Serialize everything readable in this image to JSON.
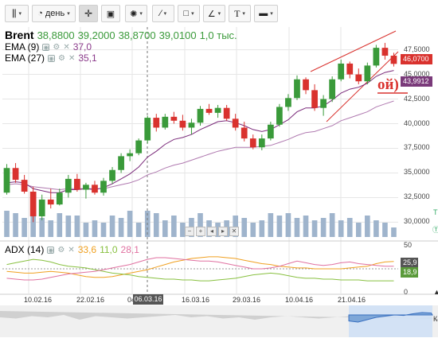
{
  "toolbar": {
    "period_label": "день",
    "caret": "▾"
  },
  "main_legend": {
    "symbol": "Brent",
    "open": "38,8800",
    "high": "39,2000",
    "low": "38,8700",
    "close": "39,0100",
    "volume": "1,0 тыс."
  },
  "ema9": {
    "label": "EMA (9)",
    "value": "37,0",
    "color": "#8b3a8b"
  },
  "ema27": {
    "label": "EMA (27)",
    "value": "35,1",
    "color": "#8b3a8b"
  },
  "adx": {
    "label": "ADX (14)",
    "v1": "33,6",
    "v2": "11,0",
    "v3": "28,1",
    "c1": "#f0a020",
    "c2": "#88c040",
    "c3": "#e070a0"
  },
  "annotation_text": "ой)",
  "price_tags": {
    "last": "46,0700",
    "ema": "43,9912",
    "adx1": "25,9",
    "adx2": "18,9",
    "last_color": "#d9322e",
    "ema_color": "#7a3a7a"
  },
  "y_axis": [
    "47,5000",
    "45,0000",
    "42,5000",
    "40,0000",
    "37,5000",
    "35,0000",
    "32,5000",
    "30,0000"
  ],
  "adx_axis": [
    "50",
    "0"
  ],
  "x_axis": [
    "10.02.16",
    "22.02.16",
    "04.03.16",
    "16.03.16",
    "29.03.16",
    "10.04.16",
    "21.04.16"
  ],
  "cursor_date": "06.03.16",
  "nav_controls": [
    "−",
    "+",
    "◂",
    "▸",
    "✕"
  ],
  "right_edge_glyphs": [
    "T",
    "Ⓣ",
    "▲",
    "К"
  ],
  "colors": {
    "up": "#3a9a3a",
    "down": "#d9322e",
    "volume": "#9fb4cc",
    "grid": "#e6e6e6"
  },
  "chart_data": {
    "type": "candlestick",
    "ylim": [
      28.5,
      49.0
    ],
    "candles": [
      {
        "o": 33.0,
        "h": 35.9,
        "l": 32.8,
        "c": 35.5
      },
      {
        "o": 35.5,
        "h": 36.0,
        "l": 34.0,
        "c": 34.3
      },
      {
        "o": 34.3,
        "h": 34.8,
        "l": 32.9,
        "c": 33.1
      },
      {
        "o": 33.1,
        "h": 33.6,
        "l": 30.0,
        "c": 30.6
      },
      {
        "o": 30.6,
        "h": 32.8,
        "l": 30.2,
        "c": 32.3
      },
      {
        "o": 32.3,
        "h": 33.4,
        "l": 31.4,
        "c": 31.8
      },
      {
        "o": 31.8,
        "h": 33.4,
        "l": 31.7,
        "c": 33.0
      },
      {
        "o": 33.0,
        "h": 34.8,
        "l": 32.5,
        "c": 34.4
      },
      {
        "o": 34.4,
        "h": 34.9,
        "l": 33.1,
        "c": 33.3
      },
      {
        "o": 33.3,
        "h": 34.0,
        "l": 32.4,
        "c": 33.8
      },
      {
        "o": 33.8,
        "h": 34.2,
        "l": 32.8,
        "c": 33.0
      },
      {
        "o": 33.0,
        "h": 34.5,
        "l": 32.7,
        "c": 34.2
      },
      {
        "o": 34.2,
        "h": 35.6,
        "l": 33.9,
        "c": 35.3
      },
      {
        "o": 35.3,
        "h": 37.0,
        "l": 35.0,
        "c": 36.7
      },
      {
        "o": 36.7,
        "h": 37.4,
        "l": 36.2,
        "c": 37.0
      },
      {
        "o": 37.0,
        "h": 38.5,
        "l": 36.8,
        "c": 38.3
      },
      {
        "o": 38.3,
        "h": 40.8,
        "l": 38.0,
        "c": 40.6
      },
      {
        "o": 40.6,
        "h": 41.0,
        "l": 39.2,
        "c": 39.6
      },
      {
        "o": 39.6,
        "h": 41.0,
        "l": 39.4,
        "c": 40.7
      },
      {
        "o": 40.7,
        "h": 41.2,
        "l": 40.0,
        "c": 40.3
      },
      {
        "o": 40.3,
        "h": 40.9,
        "l": 39.3,
        "c": 39.6
      },
      {
        "o": 39.6,
        "h": 40.5,
        "l": 38.9,
        "c": 40.1
      },
      {
        "o": 40.1,
        "h": 41.8,
        "l": 39.8,
        "c": 41.5
      },
      {
        "o": 41.5,
        "h": 42.0,
        "l": 40.9,
        "c": 41.1
      },
      {
        "o": 41.1,
        "h": 41.9,
        "l": 40.6,
        "c": 41.6
      },
      {
        "o": 41.6,
        "h": 41.9,
        "l": 40.3,
        "c": 40.5
      },
      {
        "o": 40.5,
        "h": 41.0,
        "l": 39.3,
        "c": 39.6
      },
      {
        "o": 39.6,
        "h": 40.2,
        "l": 38.2,
        "c": 38.5
      },
      {
        "o": 38.5,
        "h": 38.9,
        "l": 37.4,
        "c": 37.6
      },
      {
        "o": 37.6,
        "h": 38.9,
        "l": 37.3,
        "c": 38.5
      },
      {
        "o": 38.5,
        "h": 40.2,
        "l": 38.3,
        "c": 39.9
      },
      {
        "o": 39.9,
        "h": 42.0,
        "l": 39.7,
        "c": 41.7
      },
      {
        "o": 41.7,
        "h": 43.0,
        "l": 41.3,
        "c": 42.6
      },
      {
        "o": 42.6,
        "h": 44.9,
        "l": 42.4,
        "c": 44.5
      },
      {
        "o": 44.5,
        "h": 44.7,
        "l": 43.0,
        "c": 43.4
      },
      {
        "o": 43.4,
        "h": 44.0,
        "l": 41.3,
        "c": 41.6
      },
      {
        "o": 41.6,
        "h": 42.9,
        "l": 40.8,
        "c": 42.5
      },
      {
        "o": 42.5,
        "h": 44.8,
        "l": 42.2,
        "c": 44.5
      },
      {
        "o": 44.5,
        "h": 46.5,
        "l": 44.3,
        "c": 46.1
      },
      {
        "o": 46.1,
        "h": 46.3,
        "l": 44.6,
        "c": 45.0
      },
      {
        "o": 45.0,
        "h": 45.6,
        "l": 44.0,
        "c": 44.3
      },
      {
        "o": 44.3,
        "h": 46.2,
        "l": 44.0,
        "c": 45.9
      },
      {
        "o": 45.9,
        "h": 48.0,
        "l": 45.7,
        "c": 47.7
      },
      {
        "o": 47.7,
        "h": 48.2,
        "l": 46.5,
        "c": 46.9
      },
      {
        "o": 46.9,
        "h": 47.2,
        "l": 45.8,
        "c": 46.07
      }
    ],
    "ema9": [
      34.0,
      34.1,
      34.0,
      33.4,
      33.2,
      33.0,
      33.0,
      33.3,
      33.3,
      33.4,
      33.3,
      33.5,
      33.9,
      34.4,
      34.9,
      35.6,
      36.6,
      37.2,
      37.9,
      38.4,
      38.6,
      38.9,
      39.4,
      39.8,
      40.2,
      40.3,
      40.1,
      39.8,
      39.4,
      39.2,
      39.4,
      39.9,
      40.4,
      41.2,
      41.6,
      41.6,
      41.8,
      42.4,
      43.1,
      43.5,
      43.7,
      44.1,
      44.8,
      45.2,
      45.4
    ],
    "ema27": [
      33.8,
      33.9,
      33.8,
      33.6,
      33.5,
      33.4,
      33.3,
      33.4,
      33.4,
      33.4,
      33.4,
      33.4,
      33.6,
      33.8,
      34.0,
      34.3,
      34.8,
      35.1,
      35.5,
      35.8,
      36.0,
      36.3,
      36.6,
      36.9,
      37.2,
      37.4,
      37.6,
      37.6,
      37.6,
      37.7,
      37.8,
      38.1,
      38.4,
      38.8,
      39.1,
      39.2,
      39.5,
      39.8,
      40.3,
      40.6,
      40.9,
      41.2,
      41.7,
      42.0,
      42.3
    ],
    "volume": [
      0.55,
      0.5,
      0.4,
      0.45,
      0.4,
      0.35,
      0.5,
      0.45,
      0.45,
      0.3,
      0.35,
      0.3,
      0.45,
      0.4,
      0.55,
      0.3,
      0.55,
      0.5,
      0.35,
      0.45,
      0.3,
      0.4,
      0.5,
      0.35,
      0.3,
      0.35,
      0.45,
      0.4,
      0.3,
      0.35,
      0.5,
      0.45,
      0.5,
      0.4,
      0.45,
      0.35,
      0.4,
      0.5,
      0.35,
      0.4,
      0.3,
      0.45,
      0.35,
      0.3,
      0.2
    ],
    "adx_series": [
      {
        "name": "ADX",
        "values": [
          22,
          21,
          20,
          20,
          21,
          22,
          21,
          20,
          18,
          16,
          15,
          15,
          16,
          18,
          20,
          22,
          24,
          27,
          30,
          33,
          35,
          37,
          38,
          39,
          39,
          38,
          37,
          35,
          33,
          31,
          30,
          28,
          27,
          26,
          26,
          25,
          25,
          25,
          25,
          26,
          27,
          28,
          31,
          33,
          33.6
        ]
      },
      {
        "name": "-DI",
        "values": [
          30,
          32,
          34,
          36,
          35,
          33,
          30,
          28,
          27,
          26,
          24,
          22,
          20,
          19,
          18,
          16,
          15,
          14,
          13,
          13,
          12,
          12,
          11,
          11,
          12,
          13,
          14,
          16,
          18,
          19,
          20,
          19,
          17,
          15,
          14,
          14,
          13,
          13,
          12,
          12,
          12,
          11,
          11,
          11,
          11.0
        ]
      },
      {
        "name": "+DI",
        "values": [
          14,
          13,
          12,
          12,
          13,
          15,
          17,
          19,
          20,
          21,
          22,
          24,
          26,
          28,
          30,
          33,
          36,
          38,
          38,
          37,
          36,
          35,
          34,
          34,
          33,
          31,
          29,
          27,
          25,
          25,
          26,
          28,
          31,
          34,
          32,
          30,
          29,
          30,
          32,
          33,
          31,
          30,
          29,
          28,
          28.1
        ]
      }
    ]
  }
}
